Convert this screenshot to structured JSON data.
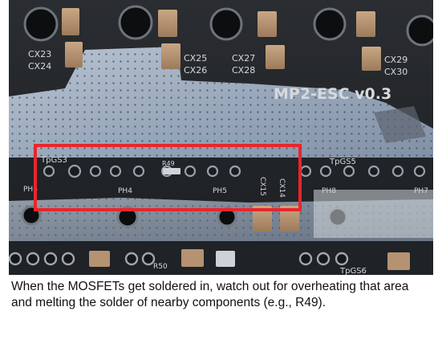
{
  "photo": {
    "silkscreen": {
      "board_label": "MP2-ESC v0.3",
      "cap_labels_top": [
        "CX23",
        "CX24",
        "CX25",
        "CX26",
        "CX27",
        "CX28",
        "CX29",
        "CX30"
      ],
      "pin_labels": [
        "TpGS3",
        "PH6",
        "R49",
        "PH4",
        "PH5",
        "CX15",
        "CX14",
        "TpGS5",
        "PH8",
        "PH7",
        "R50",
        "TpGS6"
      ]
    },
    "highlight_color": "#e8262b"
  },
  "caption": {
    "text": "When the MOSFETs get soldered in, watch out for overheating that area and melting the solder of nearby components (e.g., R49)."
  }
}
